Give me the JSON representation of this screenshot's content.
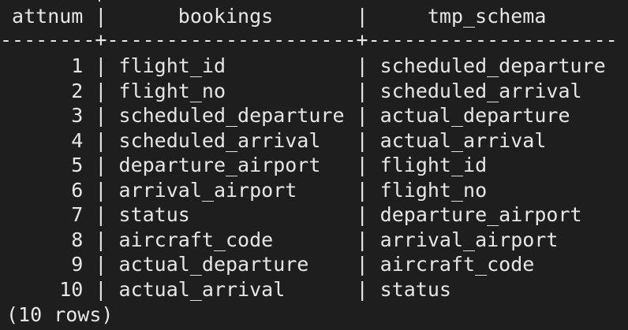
{
  "terminal": {
    "columns": {
      "attnum": "attnum",
      "bookings": "bookings",
      "tmp_schema": "tmp_schema"
    },
    "separator": "--------+---------------------+---------------------",
    "rows": [
      {
        "attnum": "1",
        "bookings": "flight_id",
        "tmp_schema": "scheduled_departure"
      },
      {
        "attnum": "2",
        "bookings": "flight_no",
        "tmp_schema": "scheduled_arrival"
      },
      {
        "attnum": "3",
        "bookings": "scheduled_departure",
        "tmp_schema": "actual_departure"
      },
      {
        "attnum": "4",
        "bookings": "scheduled_arrival",
        "tmp_schema": "actual_arrival"
      },
      {
        "attnum": "5",
        "bookings": "departure_airport",
        "tmp_schema": "flight_id"
      },
      {
        "attnum": "6",
        "bookings": "arrival_airport",
        "tmp_schema": "flight_no"
      },
      {
        "attnum": "7",
        "bookings": "status",
        "tmp_schema": "departure_airport"
      },
      {
        "attnum": "8",
        "bookings": "aircraft_code",
        "tmp_schema": "arrival_airport"
      },
      {
        "attnum": "9",
        "bookings": "actual_departure",
        "tmp_schema": "aircraft_code"
      },
      {
        "attnum": "10",
        "bookings": "actual_arrival",
        "tmp_schema": "status"
      }
    ],
    "footer": "(10 rows)"
  }
}
